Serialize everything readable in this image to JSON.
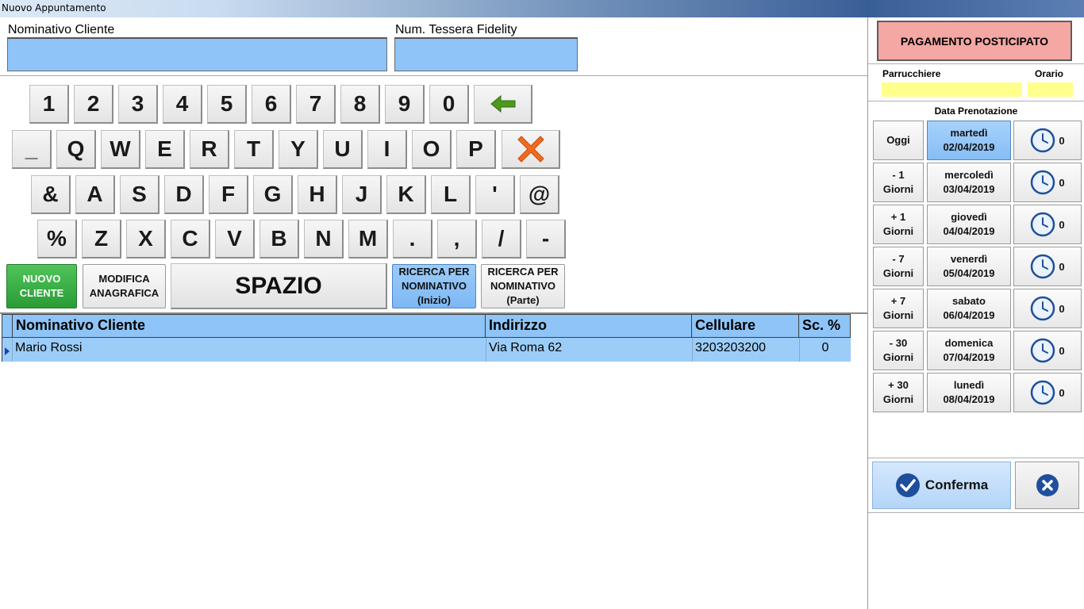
{
  "window": {
    "title": "Nuovo Appuntamento"
  },
  "search": {
    "name_label": "Nominativo Cliente",
    "name_value": "",
    "card_label": "Num. Tessera Fidelity",
    "card_value": ""
  },
  "keyboard": {
    "row1": [
      "1",
      "2",
      "3",
      "4",
      "5",
      "6",
      "7",
      "8",
      "9",
      "0"
    ],
    "row2": [
      "_",
      "Q",
      "W",
      "E",
      "R",
      "T",
      "Y",
      "U",
      "I",
      "O",
      "P"
    ],
    "row3": [
      "&",
      "A",
      "S",
      "D",
      "F",
      "G",
      "H",
      "J",
      "K",
      "L",
      "'",
      "@"
    ],
    "row4": [
      "%",
      "Z",
      "X",
      "C",
      "V",
      "B",
      "N",
      "M",
      ".",
      ",",
      "/",
      "-"
    ],
    "backspace_icon": "arrow-left-icon",
    "clear_icon": "red-x-icon",
    "new_client": [
      "NUOVO",
      "CLIENTE"
    ],
    "edit_client": [
      "MODIFICA",
      "ANAGRAFICA"
    ],
    "space": "SPAZIO",
    "search_start": [
      "RICERCA PER",
      "NOMINATIVO",
      "(Inizio)"
    ],
    "search_part": [
      "RICERCA PER",
      "NOMINATIVO",
      "(Parte)"
    ]
  },
  "grid": {
    "headers": [
      "Nominativo Cliente",
      "Indirizzo",
      "Cellulare",
      "Sc. %"
    ],
    "rows": [
      {
        "name": "Mario Rossi",
        "address": "Via Roma 62",
        "phone": "3203203200",
        "discount": "0"
      }
    ]
  },
  "side": {
    "payment_button": "PAGAMENTO POSTICIPATO",
    "hairdresser_label": "Parrucchiere",
    "time_label": "Orario",
    "date_label": "Data Prenotazione",
    "offsets": [
      [
        "Oggi"
      ],
      [
        "- 1",
        "Giorni"
      ],
      [
        "+ 1",
        "Giorni"
      ],
      [
        "- 7",
        "Giorni"
      ],
      [
        "+ 7",
        "Giorni"
      ],
      [
        "- 30",
        "Giorni"
      ],
      [
        "+ 30",
        "Giorni"
      ]
    ],
    "dates": [
      {
        "day": "martedì",
        "date": "02/04/2019",
        "count": "0"
      },
      {
        "day": "mercoledì",
        "date": "03/04/2019",
        "count": "0"
      },
      {
        "day": "giovedì",
        "date": "04/04/2019",
        "count": "0"
      },
      {
        "day": "venerdì",
        "date": "05/04/2019",
        "count": "0"
      },
      {
        "day": "sabato",
        "date": "06/04/2019",
        "count": "0"
      },
      {
        "day": "domenica",
        "date": "07/04/2019",
        "count": "0"
      },
      {
        "day": "lunedì",
        "date": "08/04/2019",
        "count": "0"
      }
    ],
    "selected_index": 0,
    "confirm": "Conferma",
    "confirm_icon": "check-icon",
    "cancel_icon": "close-icon"
  },
  "colors": {
    "field_blue": "#8ec4f7",
    "payment_red": "#f4a7a3",
    "yellow": "#ffff8c",
    "green": "#2a9c36"
  }
}
